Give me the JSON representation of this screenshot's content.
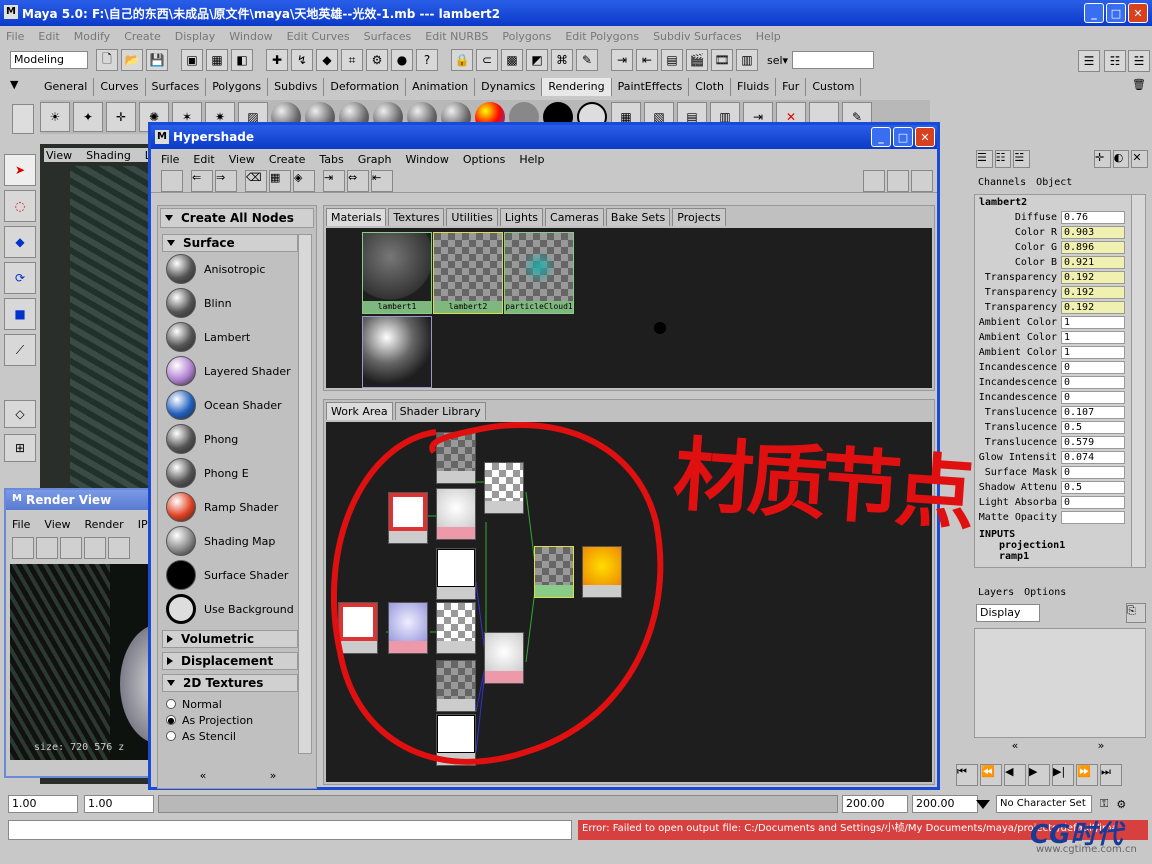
{
  "main_window": {
    "title": "Maya 5.0: F:\\自己的东西\\未成品\\原文件\\maya\\天地英雄--光效-1.mb    ---    lambert2",
    "menu": [
      "File",
      "Edit",
      "Modify",
      "Create",
      "Display",
      "Window",
      "Edit Curves",
      "Surfaces",
      "Edit NURBS",
      "Polygons",
      "Edit Polygons",
      "Subdiv Surfaces",
      "Help"
    ],
    "mode_selector": "Modeling",
    "sel_label": "sel▾",
    "shelf_tabs": [
      "General",
      "Curves",
      "Surfaces",
      "Polygons",
      "Subdivs",
      "Deformation",
      "Animation",
      "Dynamics",
      "Rendering",
      "PaintEffects",
      "Cloth",
      "Fluids",
      "Fur",
      "Custom"
    ],
    "active_shelf_tab": "Rendering"
  },
  "viewport": {
    "menu": [
      "View",
      "Shading",
      "Lig"
    ]
  },
  "render_view": {
    "title": "Render View",
    "menu": [
      "File",
      "View",
      "Render",
      "IPR"
    ],
    "size_text": "size: 720  576  z"
  },
  "hypershade": {
    "title": "Hypershade",
    "menu": [
      "File",
      "Edit",
      "View",
      "Create",
      "Tabs",
      "Graph",
      "Window",
      "Options",
      "Help"
    ],
    "create_all_nodes": "Create All Nodes",
    "surface_category": "Surface",
    "shaders": [
      {
        "name": "Anisotropic",
        "color": "#555"
      },
      {
        "name": "Blinn",
        "color": "#555"
      },
      {
        "name": "Lambert",
        "color": "#555"
      },
      {
        "name": "Layered Shader",
        "color": "#b080d0"
      },
      {
        "name": "Ocean Shader",
        "color": "#2060c0"
      },
      {
        "name": "Phong",
        "color": "#555"
      },
      {
        "name": "Phong E",
        "color": "#555"
      },
      {
        "name": "Ramp Shader",
        "color": "#e04020"
      },
      {
        "name": "Shading Map",
        "color": "#888"
      },
      {
        "name": "Surface Shader",
        "color": "#000"
      },
      {
        "name": "Use Background",
        "color": "#ddd"
      }
    ],
    "categories_collapsed": [
      "Volumetric",
      "Displacement"
    ],
    "textures_2d": "2D Textures",
    "radio_options": [
      {
        "label": "Normal",
        "checked": false
      },
      {
        "label": "As Projection",
        "checked": true
      },
      {
        "label": "As Stencil",
        "checked": false
      }
    ],
    "top_tabs": [
      "Materials",
      "Textures",
      "Utilities",
      "Lights",
      "Cameras",
      "Bake Sets",
      "Projects"
    ],
    "active_top_tab": "Materials",
    "swatches": [
      {
        "label": "lambert1",
        "kind": "sphere"
      },
      {
        "label": "lambert2",
        "kind": "checker"
      },
      {
        "label": "particleCloud1",
        "kind": "cloud"
      }
    ],
    "bottom_tabs": [
      "Work Area",
      "Shader Library"
    ],
    "active_bottom_tab": "Work Area",
    "annotation": "材质节点",
    "annotation_color": "#e01010"
  },
  "channel_box": {
    "header": [
      "Channels",
      "Object"
    ],
    "object_name": "lambert2",
    "attributes": [
      {
        "name": "Diffuse",
        "value": "0.76",
        "hl": false
      },
      {
        "name": "Color R",
        "value": "0.903",
        "hl": true
      },
      {
        "name": "Color G",
        "value": "0.896",
        "hl": true
      },
      {
        "name": "Color B",
        "value": "0.921",
        "hl": true
      },
      {
        "name": "Transparency",
        "value": "0.192",
        "hl": true
      },
      {
        "name": "Transparency",
        "value": "0.192",
        "hl": true
      },
      {
        "name": "Transparency",
        "value": "0.192",
        "hl": true
      },
      {
        "name": "Ambient Color",
        "value": "1",
        "hl": false
      },
      {
        "name": "Ambient Color",
        "value": "1",
        "hl": false
      },
      {
        "name": "Ambient Color",
        "value": "1",
        "hl": false
      },
      {
        "name": "Incandescence",
        "value": "0",
        "hl": false
      },
      {
        "name": "Incandescence",
        "value": "0",
        "hl": false
      },
      {
        "name": "Incandescence",
        "value": "0",
        "hl": false
      },
      {
        "name": "Translucence",
        "value": "0.107",
        "hl": false
      },
      {
        "name": "Translucence",
        "value": "0.5",
        "hl": false
      },
      {
        "name": "Translucence",
        "value": "0.579",
        "hl": false
      },
      {
        "name": "Glow Intensit",
        "value": "0.074",
        "hl": false
      },
      {
        "name": "Surface Mask",
        "value": "0",
        "hl": false
      },
      {
        "name": "Shadow Attenu",
        "value": "0.5",
        "hl": false
      },
      {
        "name": "Light Absorba",
        "value": "0",
        "hl": false
      },
      {
        "name": "Matte Opacity",
        "value": "",
        "hl": false
      }
    ],
    "inputs_label": "INPUTS",
    "inputs": [
      "projection1",
      "ramp1"
    ],
    "layers_header": [
      "Layers",
      "Options"
    ],
    "display_select": "Display"
  },
  "timeline": {
    "start_field": "1.00",
    "current_field": "1.00",
    "range_start": "200.00",
    "range_end": "200.00",
    "char_set": "No Character Set"
  },
  "status": {
    "error": "Error: Failed to open output file: C:/Documents and Settings/小桢/My Documents/maya/projects/default/ima",
    "watermark": "CG时代",
    "watermark_url": "www.cgtime.com.cn"
  }
}
